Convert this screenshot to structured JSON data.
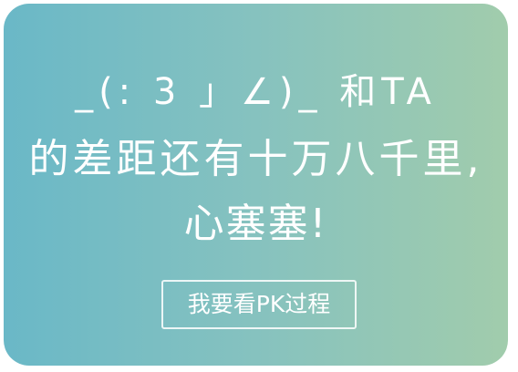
{
  "card": {
    "line1": "_(: 3 」∠)_ 和TA",
    "line2": "的差距还有十万八千里,",
    "line3": "心塞塞!",
    "button_label": "我要看PK过程"
  },
  "colors": {
    "gradient_start": "#6ab8c7",
    "gradient_end": "#a1ccac",
    "text": "#ffffff"
  }
}
